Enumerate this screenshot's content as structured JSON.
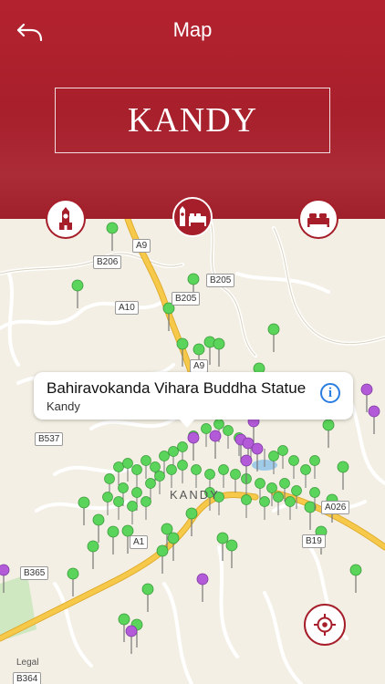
{
  "header": {
    "title": "Map",
    "city": "KANDY"
  },
  "categories": [
    {
      "name": "attractions",
      "icon": "clock-tower-icon",
      "active": false
    },
    {
      "name": "attractions-and-hotels",
      "icon": "tower-bed-icon",
      "active": true
    },
    {
      "name": "hotels",
      "icon": "bed-icon",
      "active": false
    }
  ],
  "callout": {
    "title": "Bahiravokanda Vihara Buddha Statue",
    "subtitle": "Kandy",
    "info_icon": "info-icon",
    "info_glyph": "i"
  },
  "map": {
    "road_labels": [
      "A9",
      "B206",
      "B205",
      "A10",
      "B205",
      "A9",
      "B537",
      "A1",
      "B365",
      "B364",
      "A026",
      "B19"
    ],
    "place_label": "KANDY",
    "legal": "Legal",
    "colors": {
      "attraction_pin": "#5ad45a",
      "hotel_pin": "#b25ad8",
      "major_road": "#f6c94a",
      "minor_road": "#ffffff",
      "accent": "#a61e2a"
    }
  },
  "locate": {
    "icon": "crosshair-icon"
  }
}
